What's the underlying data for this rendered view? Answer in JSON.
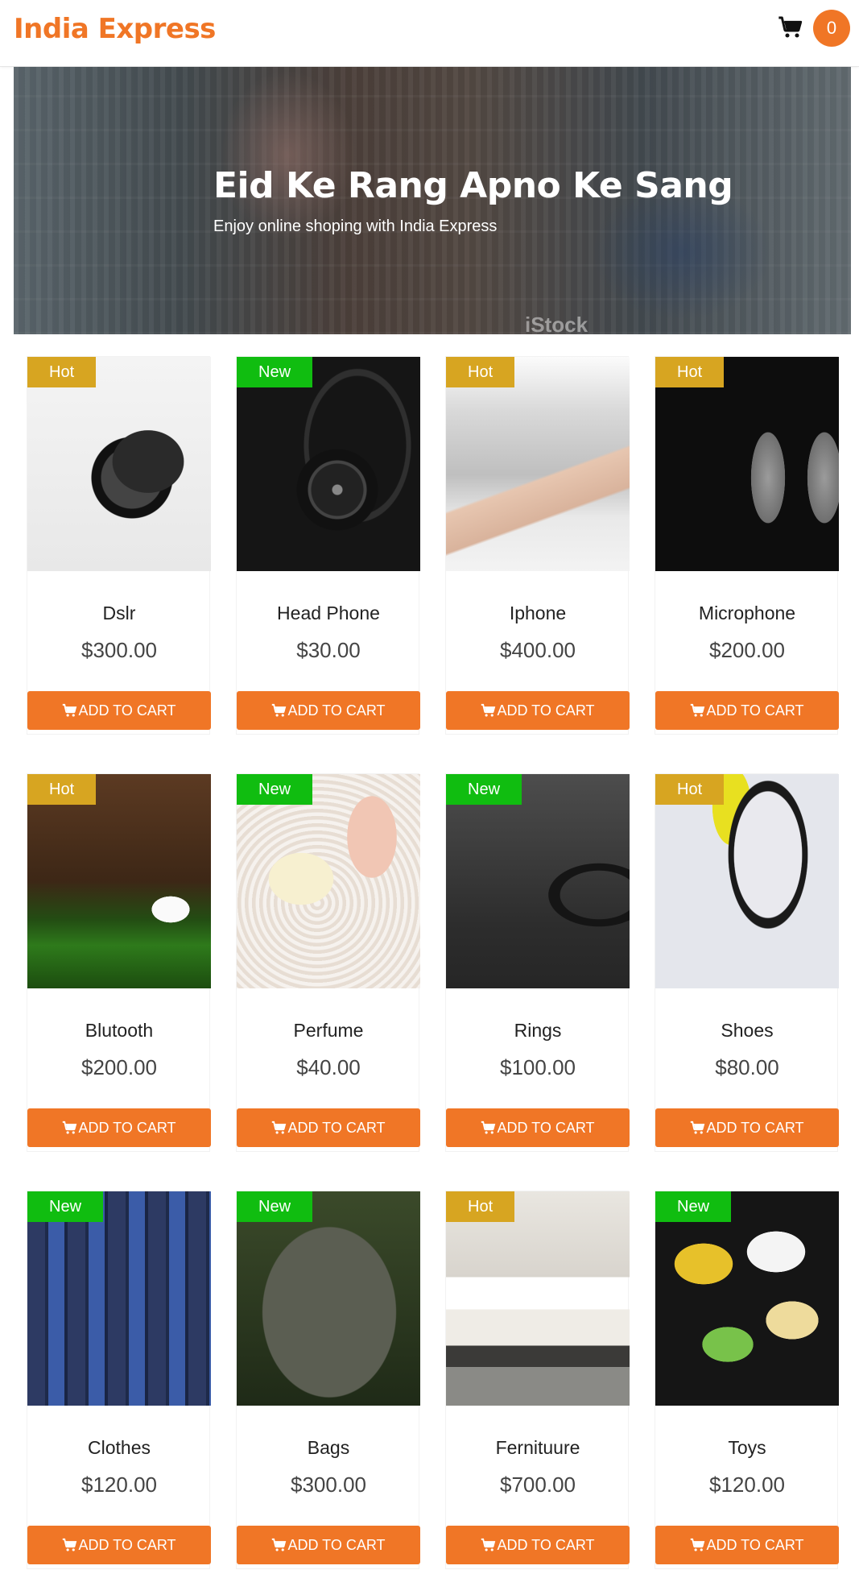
{
  "header": {
    "brand": "India Express",
    "cart_count": "0"
  },
  "hero": {
    "title": "Eid Ke Rang Apno Ke Sang",
    "subtitle": "Enjoy online shoping with India Express",
    "watermark": "iStock"
  },
  "products": [
    {
      "name": "Dslr",
      "price": "$300.00",
      "badge": "Hot",
      "button": "ADD TO CART"
    },
    {
      "name": "Head Phone",
      "price": "$30.00",
      "badge": "New",
      "button": "ADD TO CART"
    },
    {
      "name": "Iphone",
      "price": "$400.00",
      "badge": "Hot",
      "button": "ADD TO CART"
    },
    {
      "name": "Microphone",
      "price": "$200.00",
      "badge": "Hot",
      "button": "ADD TO CART"
    },
    {
      "name": "Blutooth",
      "price": "$200.00",
      "badge": "Hot",
      "button": "ADD TO CART"
    },
    {
      "name": "Perfume",
      "price": "$40.00",
      "badge": "New",
      "button": "ADD TO CART"
    },
    {
      "name": "Rings",
      "price": "$100.00",
      "badge": "New",
      "button": "ADD TO CART"
    },
    {
      "name": "Shoes",
      "price": "$80.00",
      "badge": "Hot",
      "button": "ADD TO CART"
    },
    {
      "name": "Clothes",
      "price": "$120.00",
      "badge": "New",
      "button": "ADD TO CART"
    },
    {
      "name": "Bags",
      "price": "$300.00",
      "badge": "New",
      "button": "ADD TO CART"
    },
    {
      "name": "Fernituure",
      "price": "$700.00",
      "badge": "Hot",
      "button": "ADD TO CART"
    },
    {
      "name": "Toys",
      "price": "$120.00",
      "badge": "New",
      "button": "ADD TO CART"
    }
  ],
  "colors": {
    "accent": "#f07626",
    "hot_badge": "#d7a521",
    "new_badge": "#10bd10"
  },
  "icons": {
    "cart": "shopping-cart-icon"
  }
}
